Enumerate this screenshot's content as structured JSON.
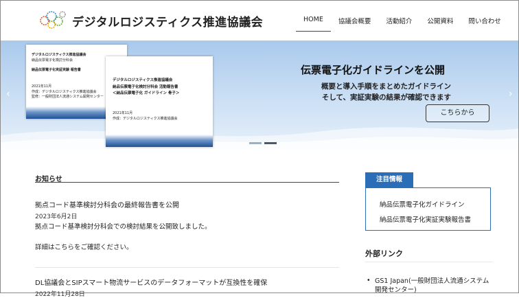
{
  "header": {
    "site_title": "デジタルロジスティクス推進協議会",
    "nav": [
      "HOME",
      "協議会概要",
      "活動紹介",
      "公開資料",
      "問い合わせ"
    ],
    "active_nav": "HOME"
  },
  "hero": {
    "doc1": {
      "lines": [
        "デジタルロジスティクス推進協議会",
        "納品伝票電子化検討分科会",
        "納品伝票電子化実証実験 報告書",
        "2021年11月",
        "作成：デジタルロジスティクス推進協議会",
        "監修：一般財団法人流通システム開発センター"
      ]
    },
    "doc2": {
      "lines": [
        "デジタルロジスティクス推進協議会",
        "納品伝票電子化検討分科会 活動報告書",
        "＜納品伝票電子化 ガイドライン 骨子＞",
        "2021年11月",
        "作成：デジタルロジスティクス推進協議会"
      ]
    },
    "headline": "伝票電子化ガイドラインを公開",
    "sub_line1": "概要と導入手順をまとめたガイドライン",
    "sub_line2": "そして、実証実験の結果が確認できます",
    "button_label": "こちらから",
    "prev_icon": "‹",
    "next_icon": "›",
    "slide_count": 2,
    "active_slide": 2
  },
  "notices": {
    "heading": "お知らせ",
    "items": [
      {
        "title": "拠点コード基準検討分科会の最終報告書を公開",
        "date": "2023年6月2日",
        "body1": "拠点コード基準検討分科会での検討結果を公開致しました。",
        "body2": "詳細はこちらをご確認ください。"
      },
      {
        "title": "DL協議会とSIPスマート物流サービスのデータフォーマットが互換性を確保",
        "date": "2022年11月28日"
      }
    ]
  },
  "sidebar": {
    "attention_tab": "注目情報",
    "attention_links": [
      "納品伝票電子化ガイドライン",
      "納品伝票電子化実証実験報告書"
    ],
    "external_heading": "外部リンク",
    "external_links": [
      "GS1 Japan(一般財団法人流通システム開発センター)"
    ],
    "bullet": "•"
  },
  "colors": {
    "accent": "#2c6db8",
    "hero_top": "#a9c9ec",
    "hero_bottom": "#e6f0fa"
  }
}
